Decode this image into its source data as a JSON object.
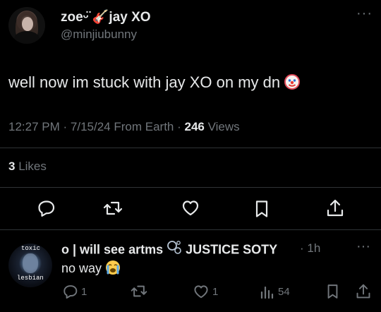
{
  "post": {
    "display_name": "zoeᵕ̈ 🎸jay XO",
    "handle": "@minjiubunny",
    "text": "well now im stuck with jay XO on my dn",
    "time": "12:27 PM",
    "date": "7/15/24",
    "source": "From Earth",
    "views_count": "246",
    "views_label": "Views",
    "likes_count": "3",
    "likes_label": "Likes",
    "more": "···"
  },
  "reply": {
    "display_name": "o | will see artms",
    "display_name_2": "JUSTICE SOTY",
    "time": "1h",
    "text": "no way",
    "avatar_text_top": "toxic",
    "avatar_text_bottom": "lesbian",
    "replies": "1",
    "likes": "1",
    "views": "54",
    "more": "···"
  },
  "colors": {
    "background": "#000000",
    "text": "#e7e9ea",
    "muted": "#71767b",
    "divider": "#2f3336"
  },
  "icons": [
    "reply-icon",
    "retweet-icon",
    "heart-icon",
    "bookmark-icon",
    "share-icon",
    "views-icon",
    "more-icon",
    "guitar-icon",
    "clown-emoji",
    "crying-emoji",
    "bubbles-icon"
  ]
}
